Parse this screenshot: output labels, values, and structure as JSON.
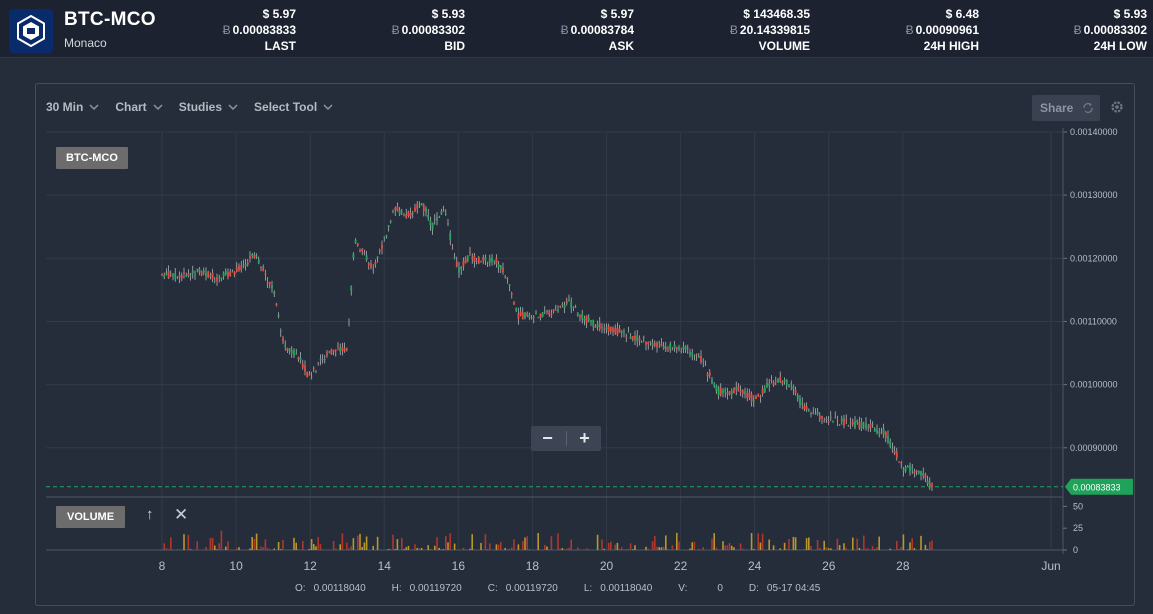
{
  "header": {
    "pair": "BTC-MCO",
    "name": "Monaco",
    "btc_symbol": "Ƀ",
    "stats": [
      {
        "usd": "$ 5.97",
        "btc": "0.00083833",
        "label": "LAST"
      },
      {
        "usd": "$ 5.93",
        "btc": "0.00083302",
        "label": "BID"
      },
      {
        "usd": "$ 5.97",
        "btc": "0.00083784",
        "label": "ASK"
      },
      {
        "usd": "$ 143468.35",
        "btc": "20.14339815",
        "label": "VOLUME"
      },
      {
        "usd": "$ 6.48",
        "btc": "0.00090961",
        "label": "24H HIGH"
      },
      {
        "usd": "$ 5.93",
        "btc": "0.00083302",
        "label": "24H LOW"
      }
    ]
  },
  "toolbar": {
    "interval": "30 Min",
    "chart": "Chart",
    "studies": "Studies",
    "tool": "Select Tool",
    "share": "Share"
  },
  "chart": {
    "symbol_badge": "BTC-MCO",
    "volume_badge": "VOLUME",
    "last_price_label": "0.00083833",
    "colors": {
      "up": "#26a65b",
      "down": "#e74c3c",
      "last": "#1fa35a",
      "grid": "#323a48"
    }
  },
  "ohlc": {
    "o_label": "O:",
    "o": "0.00118040",
    "h_label": "H:",
    "h": "0.00119720",
    "c_label": "C:",
    "c": "0.00119720",
    "l_label": "L:",
    "l": "0.00118040",
    "v_label": "V:",
    "v": "0",
    "d_label": "D:",
    "d": "05-17 04:45"
  },
  "chart_data": {
    "type": "line",
    "title": "BTC-MCO",
    "x_ticks": [
      "8",
      "10",
      "12",
      "14",
      "16",
      "18",
      "20",
      "22",
      "24",
      "26",
      "28",
      "Jun"
    ],
    "y_ticks": [
      "0.00140000",
      "0.00130000",
      "0.00120000",
      "0.00110000",
      "0.00100000",
      "0.00090000"
    ],
    "ylim": [
      0.00083,
      0.0014
    ],
    "volume_ticks": [
      "50",
      "25",
      "0"
    ],
    "series": [
      {
        "x": [
          8,
          8.5,
          9,
          9.5,
          10,
          10.5,
          11,
          11.3,
          11.6,
          12,
          12.3,
          12.7,
          13,
          13.2,
          13.4,
          13.7,
          14,
          14.3,
          14.6,
          15,
          15.3,
          15.6,
          16,
          16.3,
          16.6,
          17,
          17.3,
          17.6,
          18,
          18.5,
          19,
          19.3,
          19.6,
          20,
          20.5,
          21,
          21.5,
          22,
          22.5,
          23,
          23.3,
          23.6,
          24,
          24.3,
          24.6,
          25,
          25.3,
          25.6,
          26,
          26.5,
          27,
          27.5,
          28,
          28.5,
          28.8
        ],
        "values": [
          0.001175,
          0.001172,
          0.001178,
          0.00117,
          0.00118,
          0.001205,
          0.00115,
          0.00106,
          0.00105,
          0.00101,
          0.00104,
          0.001055,
          0.00106,
          0.00123,
          0.00121,
          0.001185,
          0.00123,
          0.00128,
          0.001265,
          0.00129,
          0.00125,
          0.00128,
          0.00118,
          0.001205,
          0.001195,
          0.0012,
          0.00117,
          0.00111,
          0.001108,
          0.001115,
          0.00113,
          0.00111,
          0.001098,
          0.00109,
          0.00108,
          0.00107,
          0.00106,
          0.001058,
          0.001045,
          0.00099,
          0.000985,
          0.000995,
          0.000975,
          0.000995,
          0.00101,
          0.001,
          0.000965,
          0.000955,
          0.000945,
          0.00094,
          0.000935,
          0.000925,
          0.00087,
          0.00086,
          0.000838
        ]
      }
    ]
  }
}
